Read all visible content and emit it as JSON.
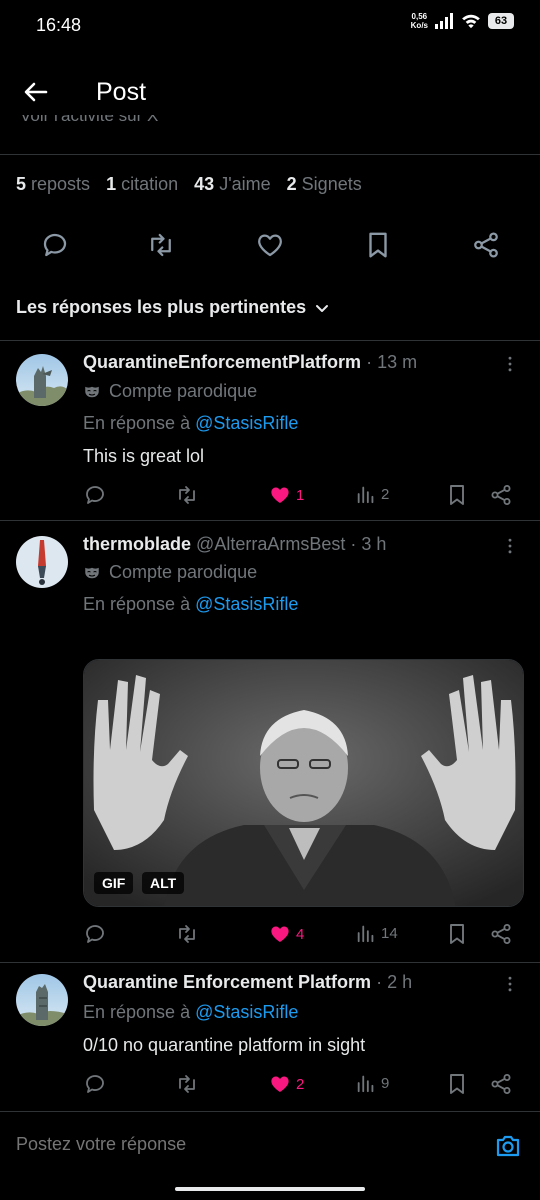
{
  "status": {
    "time": "16:48",
    "net_speed_value": "0,56",
    "net_speed_unit": "Ko/s",
    "battery": "63"
  },
  "header": {
    "title": "Post"
  },
  "peek": {
    "text": "Voir l'activité sur X"
  },
  "stats": {
    "reposts_count": "5",
    "reposts_label": "reposts",
    "quotes_count": "1",
    "quotes_label": "citation",
    "likes_count": "43",
    "likes_label": "J'aime",
    "bookmarks_count": "2",
    "bookmarks_label": "Signets"
  },
  "sort": {
    "label": "Les réponses les plus pertinentes"
  },
  "replies": [
    {
      "name": "QuarantineEnforcementPlatform",
      "handle": "",
      "time": "· 13 m",
      "parody": "Compte parodique",
      "in_reply_prefix": "En réponse à",
      "in_reply_handle": "@StasisRifle",
      "text": "This is great lol",
      "likes": "1",
      "views": "2"
    },
    {
      "name": "thermoblade",
      "handle": "@AlterraArmsBest",
      "time": "· 3 h",
      "parody": "Compte parodique",
      "in_reply_prefix": "En réponse à",
      "in_reply_handle": "@StasisRifle",
      "text": "",
      "media_badges": [
        "GIF",
        "ALT"
      ],
      "likes": "4",
      "views": "14"
    },
    {
      "name": "Quarantine Enforcement Platform",
      "handle": "",
      "time": "· 2 h",
      "in_reply_prefix": "En réponse à",
      "in_reply_handle": "@StasisRifle",
      "text": "0/10 no quarantine platform in sight",
      "likes": "2",
      "views": "9"
    }
  ],
  "compose": {
    "placeholder": "Postez votre réponse"
  },
  "colors": {
    "bg": "#000000",
    "text": "#e7e9ea",
    "muted": "#71767b",
    "link": "#1d9bf0",
    "like": "#f91880",
    "divider": "#2f3336"
  },
  "icons": [
    "back-arrow-icon",
    "reply-icon",
    "repost-icon",
    "like-icon",
    "bookmark-icon",
    "share-icon",
    "chevron-down-icon",
    "more-icon",
    "parody-mask-icon",
    "views-icon",
    "camera-icon"
  ]
}
